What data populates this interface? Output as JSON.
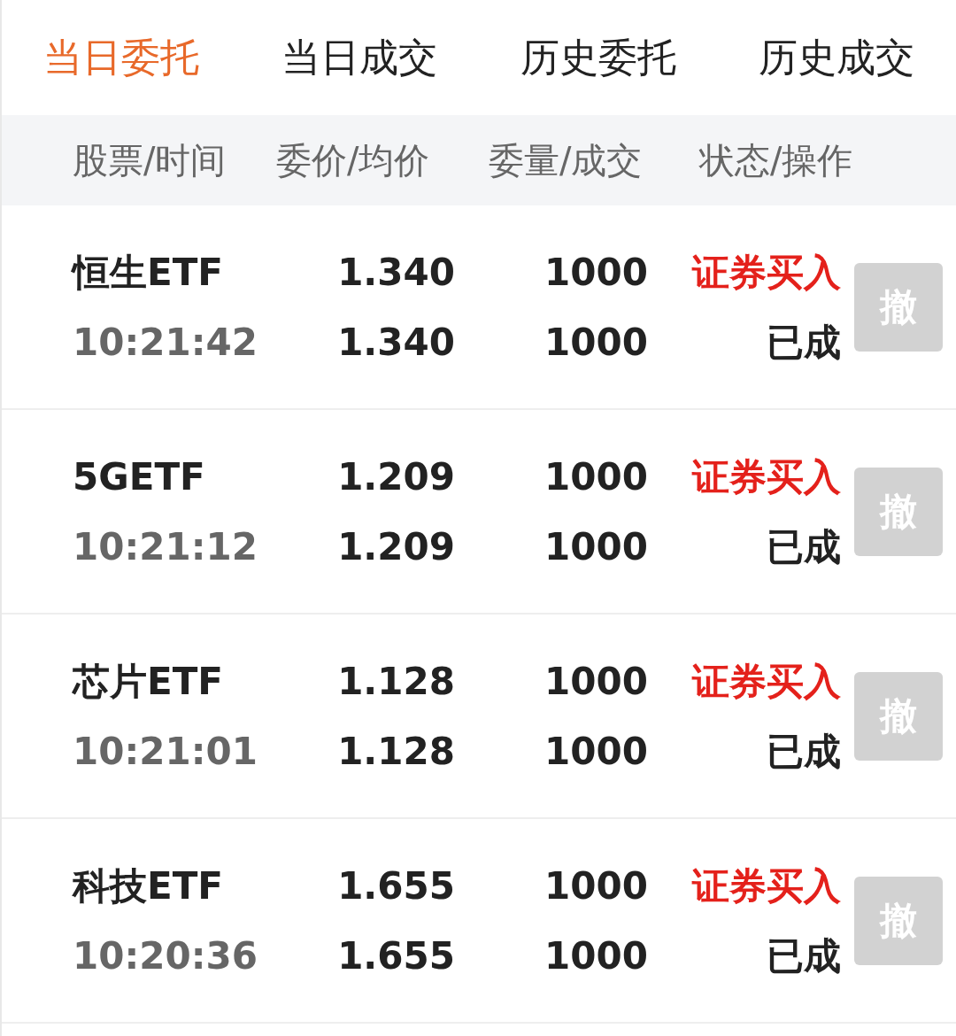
{
  "tabs": [
    {
      "label": "当日委托",
      "selected": true
    },
    {
      "label": "当日成交",
      "selected": false
    },
    {
      "label": "历史委托",
      "selected": false
    },
    {
      "label": "历史成交",
      "selected": false
    }
  ],
  "table": {
    "columns": [
      "股票/时间",
      "委价/均价",
      "委量/成交",
      "状态/操作"
    ],
    "rows": [
      {
        "name": "恒生ETF",
        "time": "10:21:42",
        "price": "1.340",
        "avg_price": "1.340",
        "quantity": "1000",
        "filled": "1000",
        "order_type": "证券买入",
        "kind": "buy",
        "status": "已成",
        "cancel": {
          "label": "撤",
          "disabled": true
        }
      },
      {
        "name": "5GETF",
        "time": "10:21:12",
        "price": "1.209",
        "avg_price": "1.209",
        "quantity": "1000",
        "filled": "1000",
        "order_type": "证券买入",
        "kind": "buy",
        "status": "已成",
        "cancel": {
          "label": "撤",
          "disabled": true
        }
      },
      {
        "name": "芯片ETF",
        "time": "10:21:01",
        "price": "1.128",
        "avg_price": "1.128",
        "quantity": "1000",
        "filled": "1000",
        "order_type": "证券买入",
        "kind": "buy",
        "status": "已成",
        "cancel": {
          "label": "撤",
          "disabled": true
        }
      },
      {
        "name": "科技ETF",
        "time": "10:20:36",
        "price": "1.655",
        "avg_price": "1.655",
        "quantity": "1000",
        "filled": "1000",
        "order_type": "证券买入",
        "kind": "buy",
        "status": "已成",
        "cancel": {
          "label": "撤",
          "disabled": true
        }
      }
    ]
  }
}
